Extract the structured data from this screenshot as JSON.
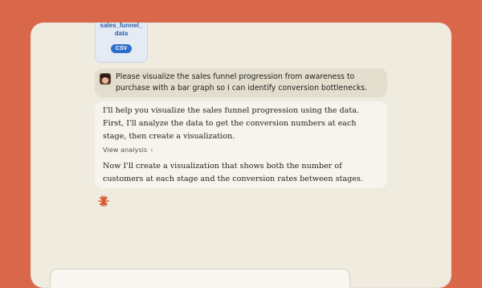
{
  "attachment": {
    "name": "sales_funnel_\ndata",
    "type_badge": "CSV",
    "icon": "file-icon"
  },
  "user_message": {
    "avatar": "avatar",
    "text": "Please visualize the sales funnel progression from awareness to purchase with a bar graph so I can identify conversion bottlenecks."
  },
  "assistant_message": {
    "paragraph1": "I'll help you visualize the sales funnel progression using the data. First, I'll analyze the data to get the conversion numbers at each stage, then create a visualization.",
    "view_analysis_label": "View analysis",
    "view_analysis_icon": "chevron-right-icon",
    "paragraph2": "Now I'll create a visualization that shows both the number of customers at each stage and the conversion rates between stages."
  },
  "status": {
    "icon": "claude-spark-icon"
  },
  "colors": {
    "background": "#d9684a",
    "frame": "#efebdf",
    "user_bubble": "#e2ddcd",
    "badge": "#2f6fcc"
  }
}
